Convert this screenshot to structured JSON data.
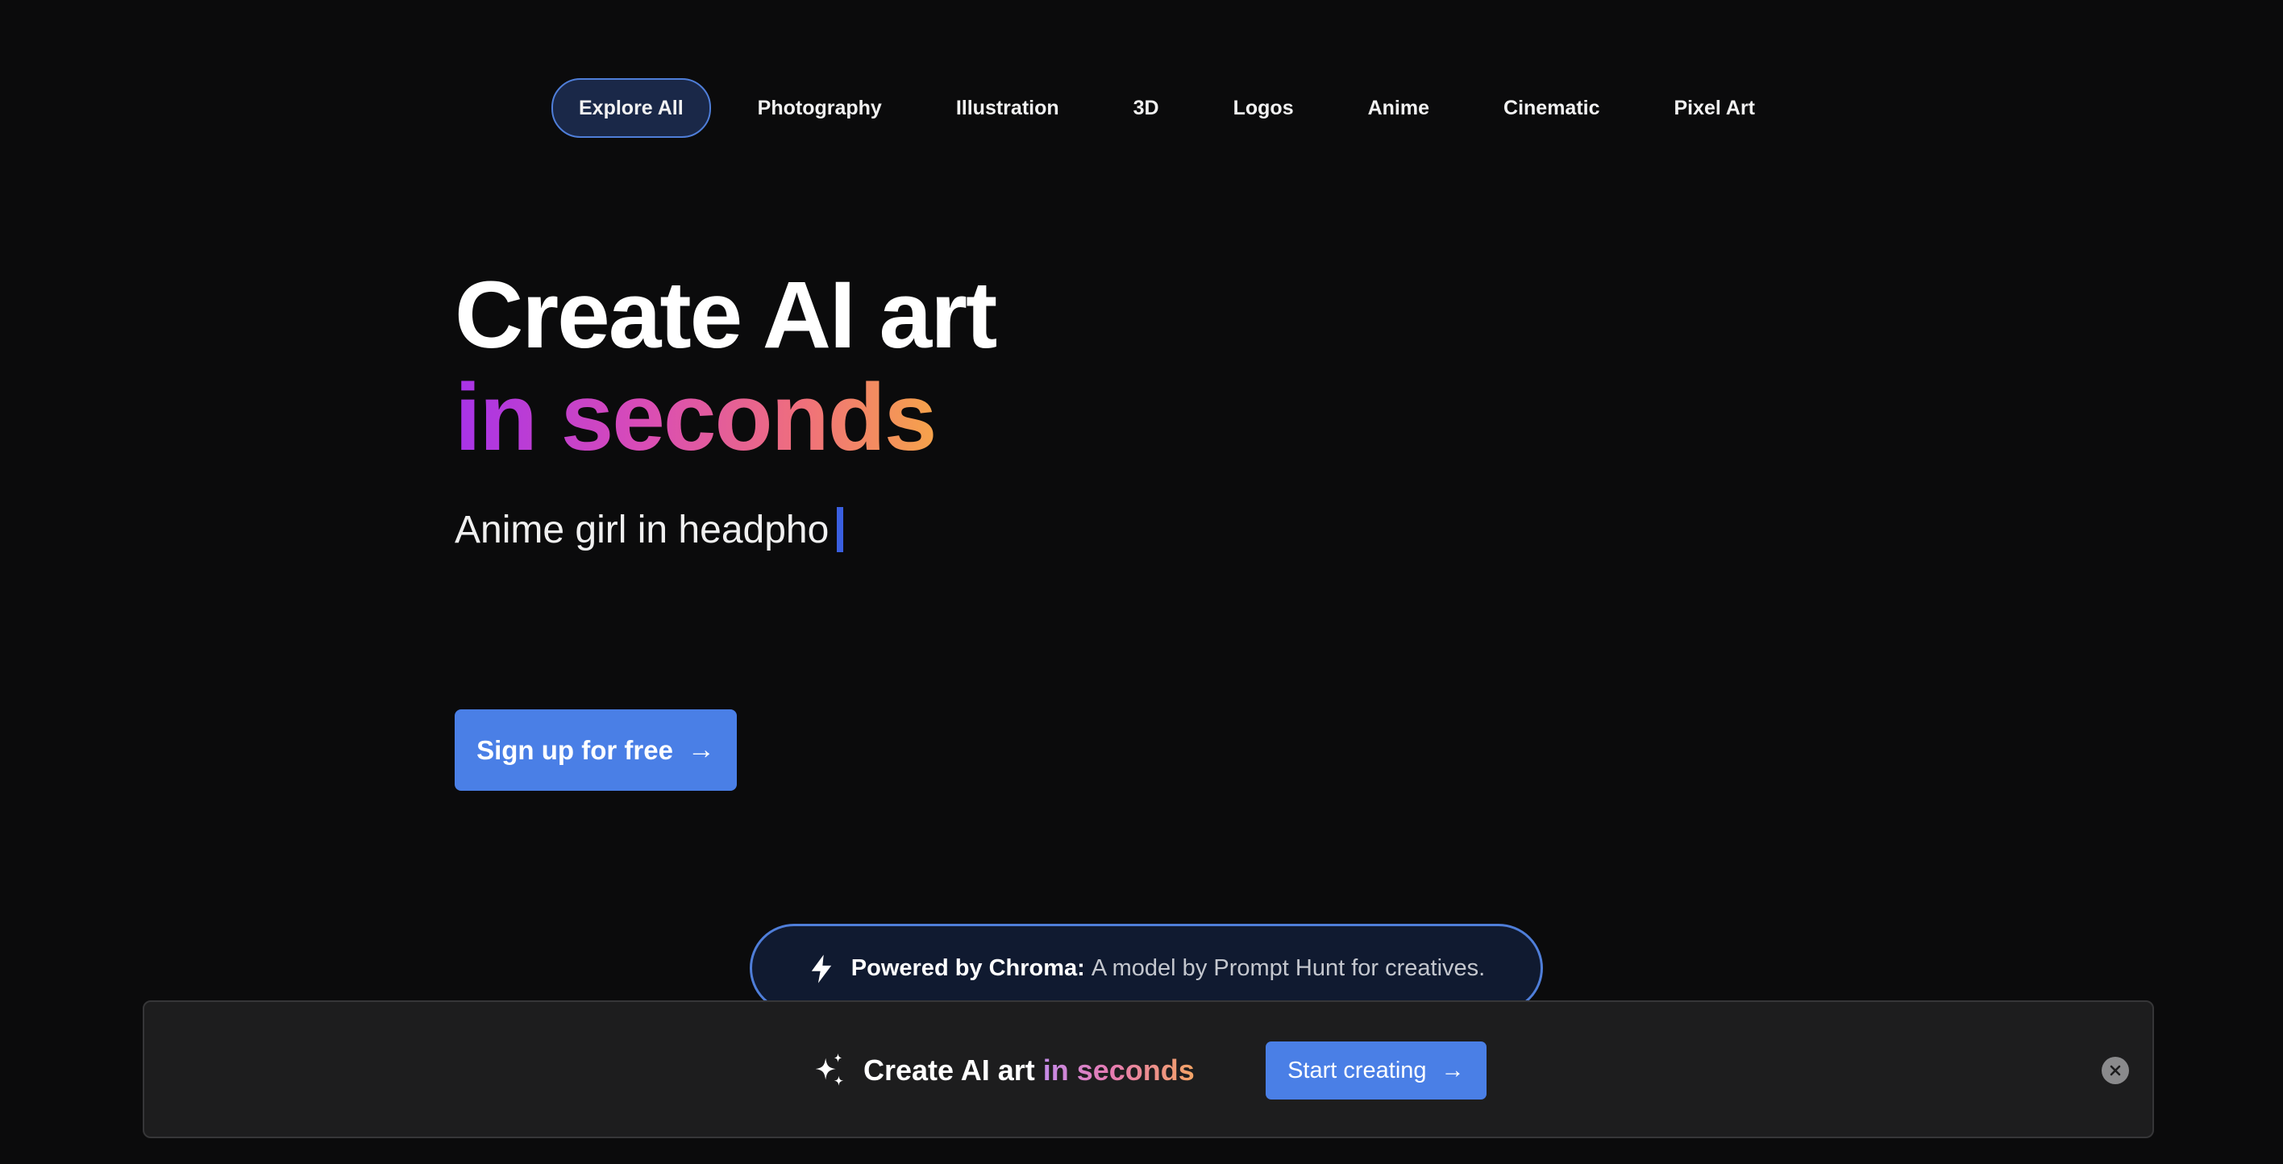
{
  "categories": {
    "items": [
      {
        "label": "Explore All"
      },
      {
        "label": "Photography"
      },
      {
        "label": "Illustration"
      },
      {
        "label": "3D"
      },
      {
        "label": "Logos"
      },
      {
        "label": "Anime"
      },
      {
        "label": "Cinematic"
      },
      {
        "label": "Pixel Art"
      }
    ],
    "active": "Explore All"
  },
  "hero": {
    "line1": "Create AI art",
    "line2": "in seconds",
    "typing_text": "Anime girl in headpho",
    "signup_label": "Sign up for free",
    "signup_icon": "arrow-right-icon"
  },
  "powered": {
    "icon": "lightning-bolt-icon",
    "strong": "Powered by Chroma:",
    "desc": "A model by Prompt Hunt for creatives."
  },
  "banner": {
    "icon": "sparkles-icon",
    "title": "Create AI art",
    "accent": "in seconds",
    "cta_label": "Start creating",
    "cta_icon": "arrow-right-icon",
    "close_icon": "close-icon"
  },
  "colors": {
    "background": "#0b0b0c",
    "accent_blue": "#4a7fe6",
    "pill_border": "#4f7ed9",
    "gradient_start": "#a733e8",
    "gradient_end": "#f6a34a",
    "caret": "#3a5fe0"
  }
}
